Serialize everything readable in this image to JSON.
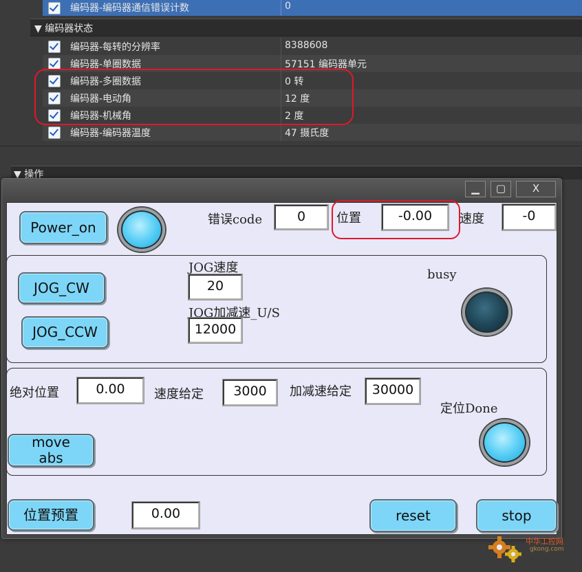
{
  "background_panel": {
    "top_row": {
      "name": "编码器-编码器通信错误计数",
      "value": "0"
    },
    "section_title": "编码器状态",
    "rows": [
      {
        "name": "编码器-每转的分辨率",
        "value": "8388608"
      },
      {
        "name": "编码器-单圈数据",
        "value": "57151 编码器单元"
      },
      {
        "name": "编码器-多圈数据",
        "value": "0 转"
      },
      {
        "name": "编码器-电动角",
        "value": "12 度"
      },
      {
        "name": "编码器-机械角",
        "value": "2 度"
      },
      {
        "name": "编码器-编码器温度",
        "value": "47 摄氏度"
      }
    ],
    "operation_section": "操作"
  },
  "window": {
    "minimize": "▁",
    "maximize": "▢",
    "close": "X"
  },
  "top": {
    "power_button": "Power_on",
    "error_label": "错误code",
    "error_value": "0",
    "position_label": "位置",
    "position_value": "-0.00",
    "speed_label": "速度",
    "speed_value": "-0"
  },
  "jog": {
    "cw_button": "JOG_CW",
    "ccw_button": "JOG_CCW",
    "speed_label": "JOG速度",
    "speed_value": "20",
    "accel_label": "JOG加减速_U/S",
    "accel_value": "12000",
    "busy_label": "busy"
  },
  "move": {
    "abs_pos_label": "绝对位置",
    "abs_pos_value": "0.00",
    "speed_label": "速度给定",
    "speed_value": "3000",
    "accel_label": "加减速给定",
    "accel_value": "30000",
    "move_button_line1": "move",
    "move_button_line2": "abs",
    "done_label": "定位Done"
  },
  "bottom": {
    "preset_button": "位置预置",
    "preset_value": "0.00",
    "reset_button": "reset",
    "stop_button": "stop"
  },
  "watermark": {
    "text": "中华工控网",
    "url": "gkong.com"
  },
  "colors": {
    "button_fill": "#7dd6f7",
    "lamp_on": "#5fd0f6",
    "lamp_off": "#1f4658",
    "annotation": "#e0182a"
  }
}
